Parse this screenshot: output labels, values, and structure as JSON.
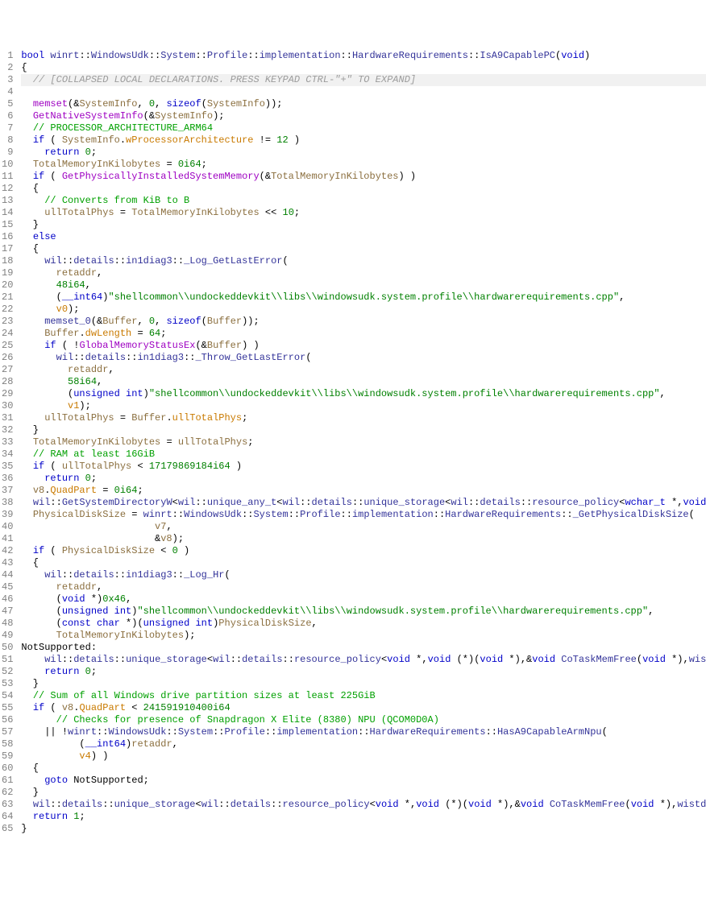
{
  "lines": [
    {
      "n": 1,
      "cls": "",
      "html": "<span class='kw'>bool</span> <span class='func-def'>winrt</span>::<span class='ns'>WindowsUdk</span>::<span class='ns'>System</span>::<span class='ns'>Profile</span>::<span class='ns'>implementation</span>::<span class='ns'>HardwareRequirements</span>::<span class='ns'>IsA9CapablePC</span>(<span class='kw'>void</span>)"
    },
    {
      "n": 2,
      "cls": "",
      "html": "{"
    },
    {
      "n": 3,
      "cls": "collapsed",
      "html": "  <span class='comment-gray'>// [COLLAPSED LOCAL DECLARATIONS. PRESS KEYPAD CTRL-\"+\" TO EXPAND]</span>"
    },
    {
      "n": 4,
      "cls": "",
      "html": ""
    },
    {
      "n": 5,
      "cls": "",
      "html": "  <span class='func-call'>memset</span>(&amp;<span class='var'>SystemInfo</span>, <span class='num'>0</span>, <span class='kw'>sizeof</span>(<span class='var'>SystemInfo</span>));"
    },
    {
      "n": 6,
      "cls": "",
      "html": "  <span class='func-call'>GetNativeSystemInfo</span>(&amp;<span class='var'>SystemInfo</span>);"
    },
    {
      "n": 7,
      "cls": "",
      "html": "  <span class='comment'>// PROCESSOR_ARCHITECTURE_ARM64</span>"
    },
    {
      "n": 8,
      "cls": "",
      "html": "  <span class='kw'>if</span> ( <span class='var'>SystemInfo</span>.<span class='member'>wProcessorArchitecture</span> != <span class='num'>12</span> )"
    },
    {
      "n": 9,
      "cls": "",
      "html": "    <span class='kw'>return</span> <span class='num'>0</span>;"
    },
    {
      "n": 10,
      "cls": "",
      "html": "  <span class='var'>TotalMemoryInKilobytes</span> = <span class='num'>0i64</span>;"
    },
    {
      "n": 11,
      "cls": "",
      "html": "  <span class='kw'>if</span> ( <span class='func-call'>GetPhysicallyInstalledSystemMemory</span>(&amp;<span class='var'>TotalMemoryInKilobytes</span>) )"
    },
    {
      "n": 12,
      "cls": "",
      "html": "  {"
    },
    {
      "n": 13,
      "cls": "",
      "html": "    <span class='comment'>// Converts from KiB to B</span>"
    },
    {
      "n": 14,
      "cls": "",
      "html": "    <span class='var'>ullTotalPhys</span> = <span class='var'>TotalMemoryInKilobytes</span> &lt;&lt; <span class='num'>10</span>;"
    },
    {
      "n": 15,
      "cls": "",
      "html": "  }"
    },
    {
      "n": 16,
      "cls": "",
      "html": "  <span class='kw'>else</span>"
    },
    {
      "n": 17,
      "cls": "",
      "html": "  {"
    },
    {
      "n": 18,
      "cls": "",
      "html": "    <span class='ns'>wil</span>::<span class='ns'>details</span>::<span class='ns'>in1diag3</span>::<span class='ns'>_Log_GetLastError</span>("
    },
    {
      "n": 19,
      "cls": "",
      "html": "      <span class='var'>retaddr</span>,"
    },
    {
      "n": 20,
      "cls": "",
      "html": "      <span class='num'>48i64</span>,"
    },
    {
      "n": 21,
      "cls": "",
      "html": "      (<span class='kw'>__int64</span>)<span class='str'>\"shellcommon\\\\undockeddevkit\\\\libs\\\\windowsudk.system.profile\\\\hardwarerequirements.cpp\"</span>,"
    },
    {
      "n": 22,
      "cls": "",
      "html": "      <span class='member'>v0</span>);"
    },
    {
      "n": 23,
      "cls": "",
      "html": "    <span class='ns'>memset_0</span>(&amp;<span class='var'>Buffer</span>, <span class='num'>0</span>, <span class='kw'>sizeof</span>(<span class='var'>Buffer</span>));"
    },
    {
      "n": 24,
      "cls": "",
      "html": "    <span class='var'>Buffer</span>.<span class='member'>dwLength</span> = <span class='num'>64</span>;"
    },
    {
      "n": 25,
      "cls": "",
      "html": "    <span class='kw'>if</span> ( !<span class='func-call'>GlobalMemoryStatusEx</span>(&amp;<span class='var'>Buffer</span>) )"
    },
    {
      "n": 26,
      "cls": "",
      "html": "      <span class='ns'>wil</span>::<span class='ns'>details</span>::<span class='ns'>in1diag3</span>::<span class='ns'>_Throw_GetLastError</span>("
    },
    {
      "n": 27,
      "cls": "",
      "html": "        <span class='var'>retaddr</span>,"
    },
    {
      "n": 28,
      "cls": "",
      "html": "        <span class='num'>58i64</span>,"
    },
    {
      "n": 29,
      "cls": "",
      "html": "        (<span class='kw'>unsigned</span> <span class='kw'>int</span>)<span class='str'>\"shellcommon\\\\undockeddevkit\\\\libs\\\\windowsudk.system.profile\\\\hardwarerequirements.cpp\"</span>,"
    },
    {
      "n": 30,
      "cls": "",
      "html": "        <span class='member'>v1</span>);"
    },
    {
      "n": 31,
      "cls": "",
      "html": "    <span class='var'>ullTotalPhys</span> = <span class='var'>Buffer</span>.<span class='member'>ullTotalPhys</span>;"
    },
    {
      "n": 32,
      "cls": "",
      "html": "  }"
    },
    {
      "n": 33,
      "cls": "",
      "html": "  <span class='var'>TotalMemoryInKilobytes</span> = <span class='var'>ullTotalPhys</span>;"
    },
    {
      "n": 34,
      "cls": "",
      "html": "  <span class='comment'>// RAM at least 16GiB</span>"
    },
    {
      "n": 35,
      "cls": "",
      "html": "  <span class='kw'>if</span> ( <span class='var'>ullTotalPhys</span> &lt; <span class='num'>17179869184i64</span> )"
    },
    {
      "n": 36,
      "cls": "",
      "html": "    <span class='kw'>return</span> <span class='num'>0</span>;"
    },
    {
      "n": 37,
      "cls": "",
      "html": "  <span class='var'>v8</span>.<span class='member'>QuadPart</span> = <span class='num'>0i64</span>;"
    },
    {
      "n": 38,
      "cls": "",
      "html": "  <span class='ns'>wil</span>::<span class='ns'>GetSystemDirectoryW</span>&lt;<span class='ns'>wil</span>::<span class='ns'>unique_any_t</span>&lt;<span class='ns'>wil</span>::<span class='ns'>details</span>::<span class='ns'>unique_storage</span>&lt;<span class='ns'>wil</span>::<span class='ns'>details</span>::<span class='ns'>resource_policy</span>&lt;<span class='kw'>wchar_t</span> *,<span class='kw'>void</span> (*)"
    },
    {
      "n": 39,
      "cls": "",
      "html": "  <span class='var'>PhysicalDiskSize</span> = <span class='ns'>winrt</span>::<span class='ns'>WindowsUdk</span>::<span class='ns'>System</span>::<span class='ns'>Profile</span>::<span class='ns'>implementation</span>::<span class='ns'>HardwareRequirements</span>::<span class='ns'>_GetPhysicalDiskSize</span>("
    },
    {
      "n": 40,
      "cls": "",
      "html": "                       <span class='var'>v7</span>,"
    },
    {
      "n": 41,
      "cls": "",
      "html": "                       &amp;<span class='var'>v8</span>);"
    },
    {
      "n": 42,
      "cls": "",
      "html": "  <span class='kw'>if</span> ( <span class='var'>PhysicalDiskSize</span> &lt; <span class='num'>0</span> )"
    },
    {
      "n": 43,
      "cls": "",
      "html": "  {"
    },
    {
      "n": 44,
      "cls": "",
      "html": "    <span class='ns'>wil</span>::<span class='ns'>details</span>::<span class='ns'>in1diag3</span>::<span class='ns'>_Log_Hr</span>("
    },
    {
      "n": 45,
      "cls": "",
      "html": "      <span class='var'>retaddr</span>,"
    },
    {
      "n": 46,
      "cls": "",
      "html": "      (<span class='kw'>void</span> *)<span class='num'>0x46</span>,"
    },
    {
      "n": 47,
      "cls": "",
      "html": "      (<span class='kw'>unsigned</span> <span class='kw'>int</span>)<span class='str'>\"shellcommon\\\\undockeddevkit\\\\libs\\\\windowsudk.system.profile\\\\hardwarerequirements.cpp\"</span>,"
    },
    {
      "n": 48,
      "cls": "",
      "html": "      (<span class='kw'>const</span> <span class='kw'>char</span> *)(<span class='kw'>unsigned</span> <span class='kw'>int</span>)<span class='var'>PhysicalDiskSize</span>,"
    },
    {
      "n": 49,
      "cls": "",
      "html": "      <span class='var'>TotalMemoryInKilobytes</span>);"
    },
    {
      "n": 50,
      "cls": "",
      "html": "<span class='label-def'>NotSupported:</span>"
    },
    {
      "n": 51,
      "cls": "",
      "html": "    <span class='ns'>wil</span>::<span class='ns'>details</span>::<span class='ns'>unique_storage</span>&lt;<span class='ns'>wil</span>::<span class='ns'>details</span>::<span class='ns'>resource_policy</span>&lt;<span class='kw'>void</span> *,<span class='kw'>void</span> (*)(<span class='kw'>void</span> *),&amp;<span class='kw'>void</span> <span class='ns'>CoTaskMemFree</span>(<span class='kw'>void</span> *),<span class='ns'>wistd</span>::"
    },
    {
      "n": 52,
      "cls": "",
      "html": "    <span class='kw'>return</span> <span class='num'>0</span>;"
    },
    {
      "n": 53,
      "cls": "",
      "html": "  }"
    },
    {
      "n": 54,
      "cls": "",
      "html": "  <span class='comment'>// Sum of all Windows drive partition sizes at least 225GiB</span>"
    },
    {
      "n": 55,
      "cls": "",
      "html": "  <span class='kw'>if</span> ( <span class='var'>v8</span>.<span class='member'>QuadPart</span> &lt; <span class='num'>241591910400i64</span>"
    },
    {
      "n": 56,
      "cls": "",
      "html": "      <span class='comment'>// Checks for presence of Snapdragon X Elite (8380) NPU (QCOM0D0A)</span>"
    },
    {
      "n": 57,
      "cls": "",
      "html": "    || !<span class='ns'>winrt</span>::<span class='ns'>WindowsUdk</span>::<span class='ns'>System</span>::<span class='ns'>Profile</span>::<span class='ns'>implementation</span>::<span class='ns'>HardwareRequirements</span>::<span class='ns'>HasA9CapableArmNpu</span>("
    },
    {
      "n": 58,
      "cls": "",
      "html": "          (<span class='kw'>__int64</span>)<span class='var'>retaddr</span>,"
    },
    {
      "n": 59,
      "cls": "",
      "html": "          <span class='member'>v4</span>) )"
    },
    {
      "n": 60,
      "cls": "",
      "html": "  {"
    },
    {
      "n": 61,
      "cls": "",
      "html": "    <span class='kw'>goto</span> <span class='goto-lbl'>NotSupported</span>;"
    },
    {
      "n": 62,
      "cls": "",
      "html": "  }"
    },
    {
      "n": 63,
      "cls": "",
      "html": "  <span class='ns'>wil</span>::<span class='ns'>details</span>::<span class='ns'>unique_storage</span>&lt;<span class='ns'>wil</span>::<span class='ns'>details</span>::<span class='ns'>resource_policy</span>&lt;<span class='kw'>void</span> *,<span class='kw'>void</span> (*)(<span class='kw'>void</span> *),&amp;<span class='kw'>void</span> <span class='ns'>CoTaskMemFree</span>(<span class='kw'>void</span> *),<span class='ns'>wistd</span>::<span class='ns'>in</span>"
    },
    {
      "n": 64,
      "cls": "",
      "html": "  <span class='kw'>return</span> <span class='num'>1</span>;"
    },
    {
      "n": 65,
      "cls": "",
      "html": "}"
    }
  ]
}
